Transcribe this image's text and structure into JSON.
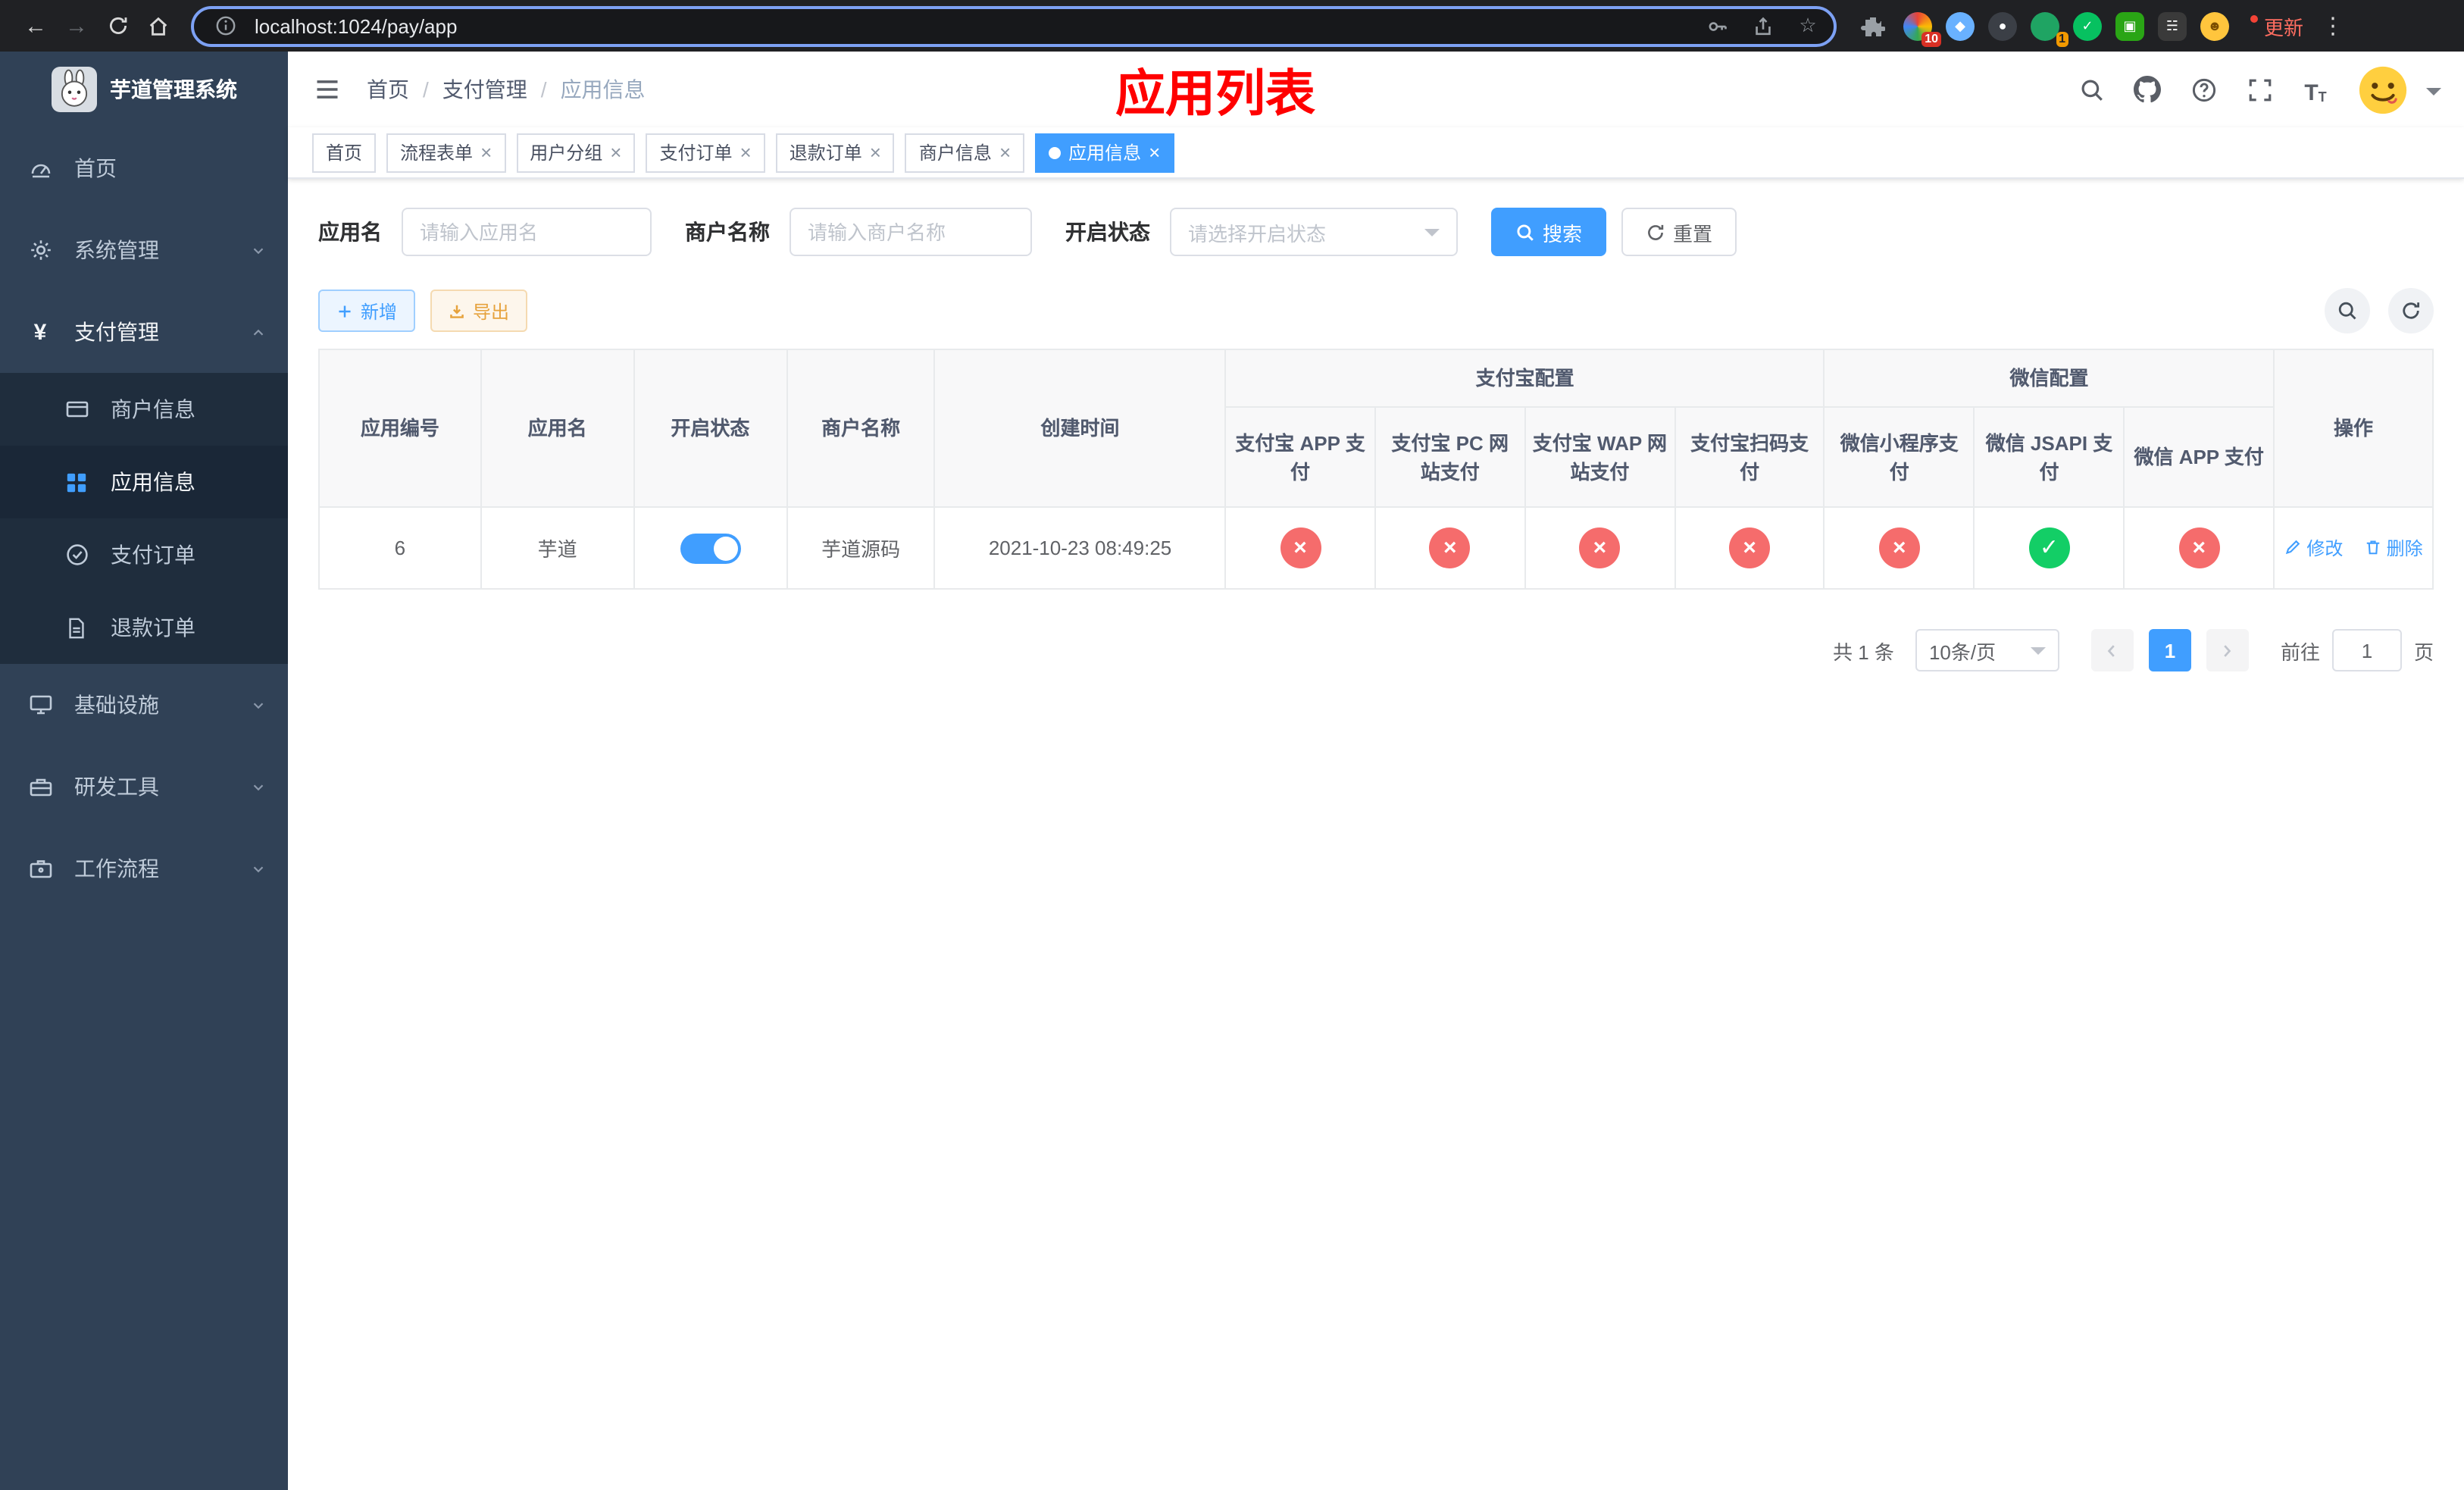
{
  "browser": {
    "url": "localhost:1024/pay/app",
    "update_label": "更新",
    "badges": {
      "ext1": "10",
      "ext4": "1"
    }
  },
  "sidebar": {
    "title": "芋道管理系统",
    "items": [
      {
        "label": "首页"
      },
      {
        "label": "系统管理"
      },
      {
        "label": "支付管理"
      },
      {
        "label": "商户信息"
      },
      {
        "label": "应用信息"
      },
      {
        "label": "支付订单"
      },
      {
        "label": "退款订单"
      },
      {
        "label": "基础设施"
      },
      {
        "label": "研发工具"
      },
      {
        "label": "工作流程"
      }
    ]
  },
  "navbar": {
    "breadcrumb": {
      "home": "首页",
      "section": "支付管理",
      "current": "应用信息"
    },
    "page_title": "应用列表"
  },
  "tabs": [
    {
      "label": "首页",
      "closable": false,
      "active": false
    },
    {
      "label": "流程表单",
      "closable": true,
      "active": false
    },
    {
      "label": "用户分组",
      "closable": true,
      "active": false
    },
    {
      "label": "支付订单",
      "closable": true,
      "active": false
    },
    {
      "label": "退款订单",
      "closable": true,
      "active": false
    },
    {
      "label": "商户信息",
      "closable": true,
      "active": false
    },
    {
      "label": "应用信息",
      "closable": true,
      "active": true
    }
  ],
  "filters": {
    "app_name_label": "应用名",
    "app_name_placeholder": "请输入应用名",
    "merchant_label": "商户名称",
    "merchant_placeholder": "请输入商户名称",
    "status_label": "开启状态",
    "status_placeholder": "请选择开启状态",
    "search_label": "搜索",
    "reset_label": "重置"
  },
  "toolbar": {
    "add_label": "新增",
    "export_label": "导出"
  },
  "table": {
    "groups": {
      "alipay": "支付宝配置",
      "wechat": "微信配置"
    },
    "columns": {
      "id": "应用编号",
      "name": "应用名",
      "status": "开启状态",
      "merchant": "商户名称",
      "created": "创建时间",
      "alipay_app": "支付宝 APP 支付",
      "alipay_pc": "支付宝 PC 网站支付",
      "alipay_wap": "支付宝 WAP 网站支付",
      "alipay_qr": "支付宝扫码支付",
      "wx_mini": "微信小程序支付",
      "wx_jsapi": "微信 JSAPI 支付",
      "wx_app": "微信 APP 支付",
      "actions": "操作"
    },
    "rows": [
      {
        "id": "6",
        "name": "芋道",
        "enabled": true,
        "merchant": "芋道源码",
        "created": "2021-10-23 08:49:25",
        "configs": [
          false,
          false,
          false,
          false,
          false,
          true,
          false
        ],
        "edit_label": "修改",
        "delete_label": "删除"
      }
    ]
  },
  "pagination": {
    "total": "共 1 条",
    "page_size": "10条/页",
    "page": "1",
    "goto": "前往",
    "goto_value": "1",
    "unit": "页"
  },
  "colors": {
    "primary": "#409eff",
    "success": "#13ce66",
    "danger": "#f56c6c",
    "warning": "#e6a23c",
    "title_red": "#ff0000",
    "sidebar_bg": "#304156",
    "submenu_bg": "#1f2d3d"
  }
}
